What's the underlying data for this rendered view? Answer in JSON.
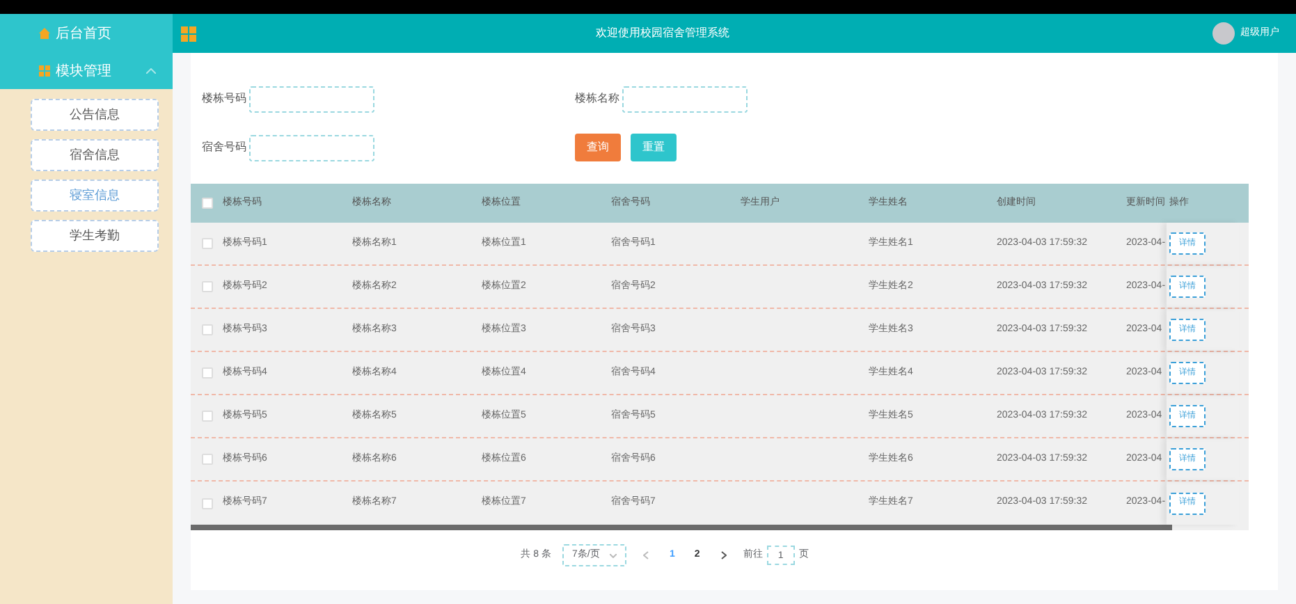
{
  "sidebar": {
    "home": "后台首页",
    "group": {
      "label": "模块管理",
      "expanded": true
    },
    "items": [
      {
        "label": "公告信息",
        "selected": false
      },
      {
        "label": "宿舍信息",
        "selected": false
      },
      {
        "label": "寝室信息",
        "selected": true
      },
      {
        "label": "学生考勤",
        "selected": false
      }
    ]
  },
  "header": {
    "title": "欢迎使用校园宿舍管理系统",
    "user": "超级用户"
  },
  "search": {
    "fields": [
      {
        "label": "楼栋号码"
      },
      {
        "label": "楼栋名称"
      },
      {
        "label": "宿舍号码"
      }
    ],
    "buttons": [
      {
        "label": "查询",
        "kind": "primary"
      },
      {
        "label": "重置",
        "kind": "secondary"
      }
    ]
  },
  "table": {
    "all_checked": false,
    "row_checked": [
      false,
      false,
      false,
      false,
      false,
      false,
      false
    ],
    "columns": [
      "楼栋号码",
      "楼栋名称",
      "楼栋位置",
      "宿舍号码",
      "学生用户",
      "学生姓名",
      "创建时间",
      "更新时间",
      "操作"
    ],
    "rows": [
      [
        "楼栋号码1",
        "楼栋名称1",
        "楼栋位置1",
        "宿舍号码1",
        "",
        "学生姓名1",
        "2023-04-03 17:59:32",
        "2023-04-",
        "详情"
      ],
      [
        "楼栋号码2",
        "楼栋名称2",
        "楼栋位置2",
        "宿舍号码2",
        "",
        "学生姓名2",
        "2023-04-03 17:59:32",
        "2023-04-",
        "详情"
      ],
      [
        "楼栋号码3",
        "楼栋名称3",
        "楼栋位置3",
        "宿舍号码3",
        "",
        "学生姓名3",
        "2023-04-03 17:59:32",
        "2023-04",
        "详情"
      ],
      [
        "楼栋号码4",
        "楼栋名称4",
        "楼栋位置4",
        "宿舍号码4",
        "",
        "学生姓名4",
        "2023-04-03 17:59:32",
        "2023-04",
        "详情"
      ],
      [
        "楼栋号码5",
        "楼栋名称5",
        "楼栋位置5",
        "宿舍号码5",
        "",
        "学生姓名5",
        "2023-04-03 17:59:32",
        "2023-04",
        "详情"
      ],
      [
        "楼栋号码6",
        "楼栋名称6",
        "楼栋位置6",
        "宿舍号码6",
        "",
        "学生姓名6",
        "2023-04-03 17:59:32",
        "2023-04",
        "详情"
      ],
      [
        "楼栋号码7",
        "楼栋名称7",
        "楼栋位置7",
        "宿舍号码7",
        "",
        "学生姓名7",
        "2023-04-03 17:59:32",
        "2023-04-",
        "详情"
      ]
    ]
  },
  "pagination": {
    "total": "共 8 条",
    "page_size": "7条/页",
    "pages": [
      {
        "label": "1",
        "selected": true
      },
      {
        "label": "2",
        "selected": false
      }
    ],
    "goto_label": "前往",
    "goto_value": "1",
    "goto_suffix": "页"
  }
}
